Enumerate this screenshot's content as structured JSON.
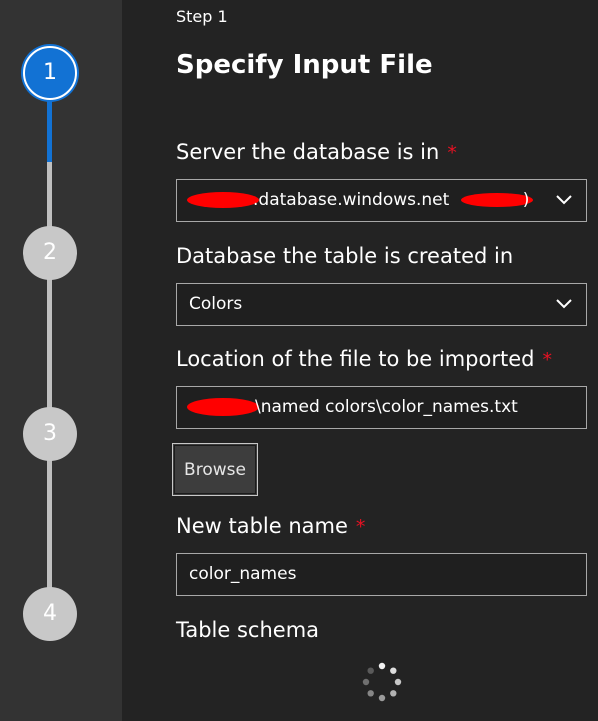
{
  "stepper": {
    "steps": [
      {
        "number": "1",
        "state": "active"
      },
      {
        "number": "2",
        "state": "pending"
      },
      {
        "number": "3",
        "state": "pending"
      },
      {
        "number": "4",
        "state": "pending"
      }
    ],
    "progress_fraction": 0.25
  },
  "header": {
    "step_caption": "Step 1",
    "title": "Specify Input File"
  },
  "form": {
    "server": {
      "label": "Server the database is in",
      "required_marker": "*",
      "value_visible": ".database.windows.net",
      "value_suffix": ")"
    },
    "database": {
      "label": "Database the table is created in",
      "value": "Colors"
    },
    "file_location": {
      "label": "Location of the file to be imported",
      "required_marker": "*",
      "value_visible": "\\named colors\\color_names.txt"
    },
    "browse_label": "Browse",
    "table_name": {
      "label": "New table name",
      "required_marker": "*",
      "value": "color_names"
    },
    "schema": {
      "label": "Table schema"
    }
  },
  "icons": {
    "dropdown": "chevron-down-icon",
    "loading": "loading-spinner-icon"
  },
  "colors": {
    "accent": "#1272d4",
    "required": "#e81123",
    "rail_bg": "#333333",
    "panel_bg": "#232323",
    "step_pending": "#c8c8c8",
    "redaction": "#ff0000"
  }
}
